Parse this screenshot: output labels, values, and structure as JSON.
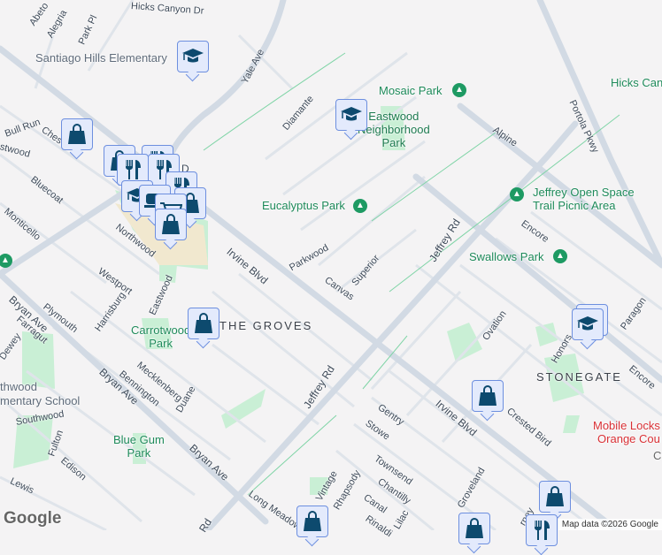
{
  "streets": {
    "hicks_canyon": "Hicks Canyon Dr",
    "abeto": "Abeto",
    "alegria": "Alegria",
    "park_pl": "Park Pl",
    "yale_ave_n": "Yale Ave",
    "yale_ave_w": "Yale Ave",
    "diamante": "Diamante",
    "bull_run": "Bull Run",
    "chesapeake": "Ches",
    "eastwood_w": "stwood",
    "bluecoat": "Bluecoat",
    "monticello": "Monticello",
    "northwood": "Northwood",
    "irvine_blvd_1": "Irvine Blvd",
    "irvine_blvd_2": "Irvine Blvd",
    "parkwood": "Parkwood",
    "canvas": "Canvas",
    "superior": "Superior",
    "jeffrey_rd_1": "Jeffrey Rd",
    "jeffrey_rd_2": "Jeffrey Rd",
    "jeffrey_rd_3": "Rd",
    "alpine": "Alpine",
    "encore_1": "Encore",
    "encore_2": "Encore",
    "portola": "Portola Pkwy",
    "ovation": "Ovation",
    "honors": "Honors",
    "paragon": "Paragon",
    "westport": "Westport",
    "harrisburg": "Harrisburg",
    "eastwood": "Eastwood",
    "plymouth": "Plymouth",
    "bryan_1": "Bryan Ave",
    "bryan_2": "Bryan Ave",
    "bryan_3": "Bryan Ave",
    "farragut": "Farragut",
    "dewey": "Dewey",
    "mecklenberg": "Mecklenberg",
    "bennington": "Bennington",
    "duane": "Duane",
    "southwood": "Southwood",
    "fulton": "Fulton",
    "edison": "Edison",
    "lewis": "Lewis",
    "gentry": "Gentry",
    "stowe": "Stowe",
    "townsend": "Townsend",
    "chantilly": "Chantilly",
    "canal": "Canal",
    "rinaldi": "Rinaldi",
    "lilac": "Lilac",
    "rhapsody": "Rhapsody",
    "vintage": "Vintage",
    "long_meadow": "Long Meadow",
    "groveland": "Groveland",
    "crested_bird": "Crested Bird",
    "journey": "rney",
    "cr": "Cr",
    "d": "D"
  },
  "places": {
    "santiago": "Santiago Hills Elementary",
    "mosaic": "Mosaic Park",
    "eastwood_park": "Eastwood\nNeighborhood\nPark",
    "eucalyptus": "Eucalyptus Park",
    "jeffrey_os": "Jeffrey Open Space\nTrail Picnic Area",
    "swallows": "Swallows Park",
    "hicks": "Hicks Can",
    "carrotwood": "Carrotwood\nPark",
    "northwood_school": "thwood\nmentary School",
    "blue_gum": "Blue Gum\nPark",
    "mobile_locks": "Mobile Locks\nOrange Cou"
  },
  "neighborhoods": {
    "groves": "THE GROVES",
    "stonegate": "STONEGATE"
  },
  "footer": {
    "attribution": "Map data ©2026 Google",
    "logo": "Google"
  },
  "colors": {
    "background": "#f4f3f4",
    "road": "#d5dce6",
    "park": "#c9efd5",
    "marker_fill": "#e3eafc",
    "marker_icon": "#0d4a6e"
  }
}
